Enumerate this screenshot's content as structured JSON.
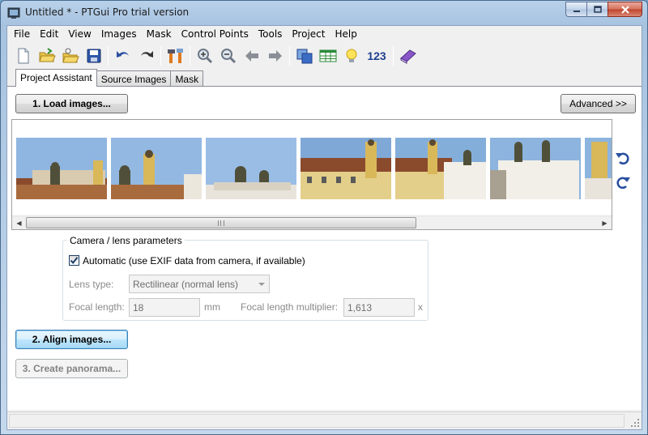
{
  "window": {
    "title": "Untitled * - PTGui Pro trial version",
    "minimize_label": "minimize",
    "maximize_label": "maximize",
    "close_label": "close"
  },
  "menu": {
    "items": [
      "File",
      "Edit",
      "View",
      "Images",
      "Mask",
      "Control Points",
      "Tools",
      "Project",
      "Help"
    ]
  },
  "toolbar": {
    "icons": [
      "new-document-icon",
      "open-folder-icon",
      "open-recent-icon",
      "save-icon",
      "undo-icon",
      "redo-icon",
      "tools-icon",
      "zoom-in-icon",
      "zoom-out-icon",
      "back-arrow-icon",
      "forward-arrow-icon",
      "panorama-editor-icon",
      "table-icon",
      "lightbulb-icon",
      "help-book-icon"
    ],
    "number_label": "123"
  },
  "tabs": [
    "Project Assistant",
    "Source Images",
    "Mask"
  ],
  "active_tab": "Project Assistant",
  "buttons": {
    "load_images": "1. Load images...",
    "advanced": "Advanced >>",
    "align_images": "2. Align images...",
    "create_panorama": "3. Create panorama..."
  },
  "image_strip": {
    "thumbnails": [
      "thumb-1",
      "thumb-2",
      "thumb-3",
      "thumb-4",
      "thumb-5",
      "thumb-6",
      "thumb-7"
    ],
    "scroll_grip": "III"
  },
  "camera": {
    "group_title": "Camera / lens parameters",
    "automatic_label": "Automatic (use EXIF data from camera, if available)",
    "automatic_checked": true,
    "lens_type_label": "Lens type:",
    "lens_type_value": "Rectilinear (normal lens)",
    "focal_length_label": "Focal length:",
    "focal_length_value": "18",
    "focal_length_unit": "mm",
    "multiplier_label": "Focal length multiplier:",
    "multiplier_value": "1,613",
    "multiplier_unit": "x"
  },
  "colors": {
    "accent_blue": "#1d3f8f",
    "sky": "#7fa8d6",
    "building_yellow": "#d9b85a"
  }
}
